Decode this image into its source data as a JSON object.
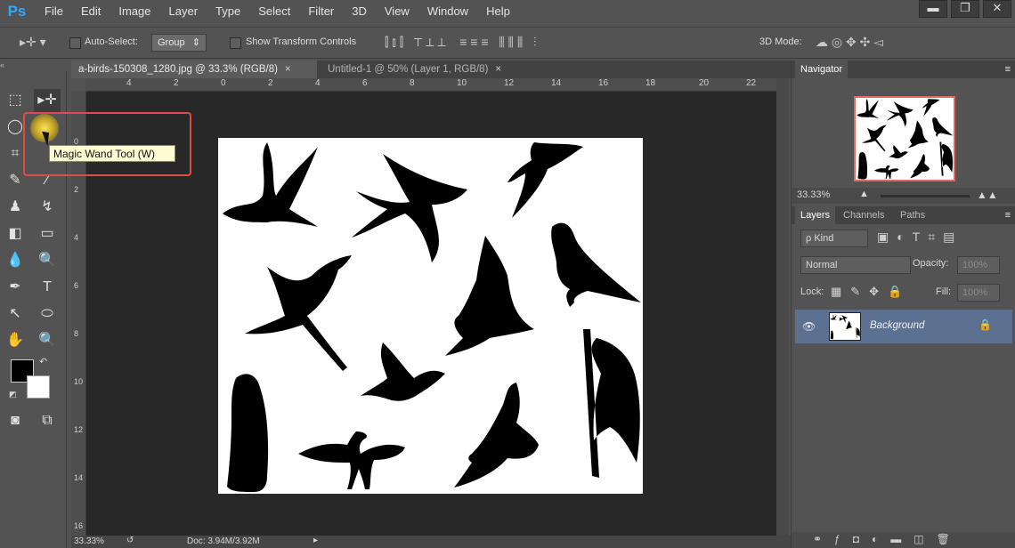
{
  "app": {
    "logo": "Ps",
    "menus": [
      "File",
      "Edit",
      "Image",
      "Layer",
      "Type",
      "Select",
      "Filter",
      "3D",
      "View",
      "Window",
      "Help"
    ],
    "window_buttons": [
      "▬",
      "❐",
      "✕"
    ]
  },
  "options": {
    "auto_select_label": "Auto-Select:",
    "auto_select_value": "Group",
    "show_transform_label": "Show Transform Controls",
    "mode_3d_label": "3D Mode:"
  },
  "tabs": [
    {
      "label": "a-birds-150308_1280.jpg @ 33.3% (RGB/8)",
      "close": "×"
    },
    {
      "label": "Untitled-1 @ 50% (Layer 1, RGB/8)",
      "close": "×"
    }
  ],
  "ruler": {
    "top": [
      "4",
      "2",
      "0",
      "2",
      "4",
      "6",
      "8",
      "10",
      "12",
      "14",
      "16",
      "18",
      "20",
      "22"
    ],
    "left": [
      "0",
      "2",
      "4",
      "6",
      "8",
      "10",
      "12",
      "14",
      "16"
    ]
  },
  "tooltip": "Magic Wand Tool (W)",
  "status": {
    "zoom": "33.33%",
    "doc": "Doc: 3.94M/3.92M"
  },
  "navigator": {
    "title": "Navigator",
    "zoom": "33.33%"
  },
  "layers_panel": {
    "tabs": [
      "Layers",
      "Channels",
      "Paths"
    ],
    "kind_label": "ρ Kind",
    "blend_mode": "Normal",
    "opacity_label": "Opacity:",
    "opacity_value": "100%",
    "lock_label": "Lock:",
    "fill_label": "Fill:",
    "fill_value": "100%",
    "layers": [
      {
        "name": "Background",
        "visible": true,
        "locked": true
      }
    ]
  },
  "colors": {
    "accent_highlight": "#e14a45",
    "layer_selected": "#5c7191",
    "canvas_bg": "#282828"
  }
}
